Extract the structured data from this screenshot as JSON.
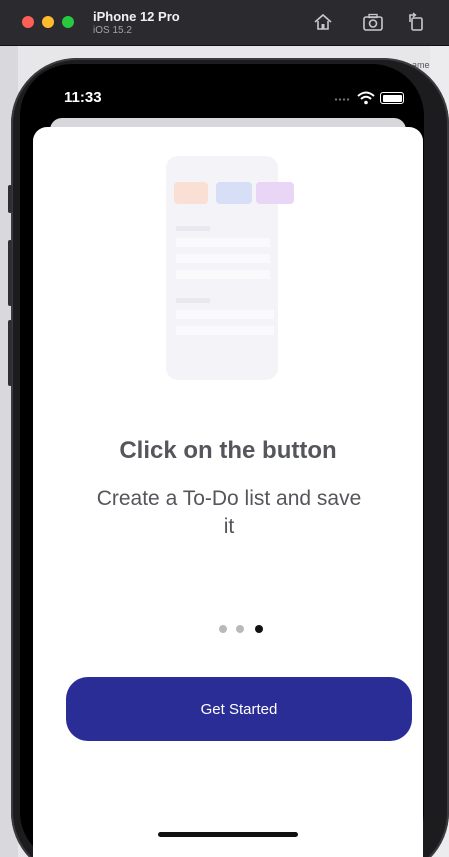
{
  "simulator": {
    "device_name": "iPhone 12 Pro",
    "os_version": "iOS 15.2",
    "toolbar_icons": [
      "home-icon",
      "screenshot-icon",
      "rotate-icon"
    ],
    "background_text": "ame"
  },
  "status_bar": {
    "time": "11:33",
    "icons": [
      "signal-dots-icon",
      "wifi-icon",
      "battery-icon"
    ]
  },
  "onboarding": {
    "title": "Click on the button",
    "subtitle": "Create a To-Do list and save it",
    "page_indicator": {
      "total": 3,
      "current": 3
    },
    "cta_label": "Get Started"
  },
  "colors": {
    "accent": "#2a2d96",
    "text": "#55565b",
    "dot_active": "#111111",
    "dot_inactive": "#b9b9bd"
  }
}
